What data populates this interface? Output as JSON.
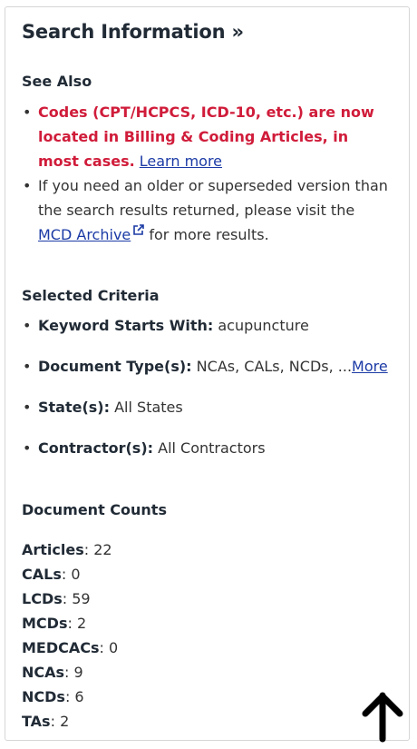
{
  "heading": "Search Information »",
  "see_also": {
    "title": "See Also",
    "notice_text": "Codes (CPT/HCPCS, ICD-10, etc.) are now located in Billing & Coding Articles, in most cases.",
    "notice_link": "Learn more",
    "archive_text_pre": "If you need an older or superseded version than the search results returned, please visit the",
    "archive_link": "MCD Archive",
    "archive_text_post": "for more results."
  },
  "criteria": {
    "title": "Selected Criteria",
    "items": [
      {
        "label": "Keyword Starts With:",
        "value": "acupuncture"
      },
      {
        "label": "Document Type(s):",
        "value": "NCAs, CALs, NCDs, ...",
        "link": "More"
      },
      {
        "label": "State(s):",
        "value": "All States"
      },
      {
        "label": "Contractor(s):",
        "value": "All Contractors"
      }
    ]
  },
  "counts": {
    "title": "Document Counts",
    "items": [
      {
        "label": "Articles",
        "value": "22"
      },
      {
        "label": "CALs",
        "value": "0"
      },
      {
        "label": "LCDs",
        "value": "59"
      },
      {
        "label": "MCDs",
        "value": "2"
      },
      {
        "label": "MEDCACs",
        "value": "0"
      },
      {
        "label": "NCAs",
        "value": "9"
      },
      {
        "label": "NCDs",
        "value": "6"
      },
      {
        "label": "TAs",
        "value": "2"
      }
    ]
  },
  "icons": {
    "external": "external-link-icon",
    "back_to_top": "arrow-up-icon"
  },
  "colors": {
    "notice": "#d01c3a",
    "link": "#1b3aa5",
    "heading": "#212b36"
  }
}
